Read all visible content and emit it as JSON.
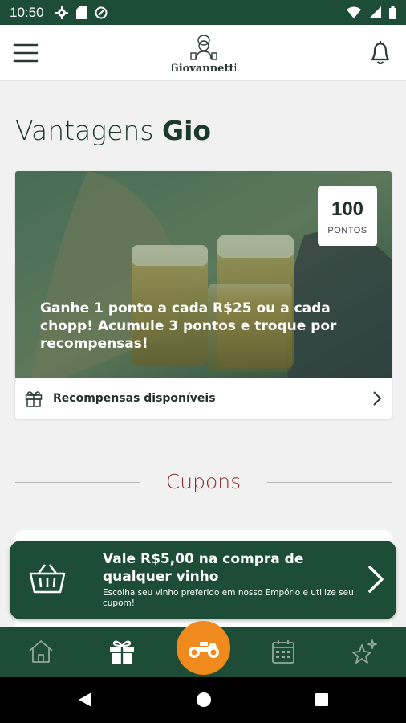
{
  "status_bar": {
    "time": "10:50"
  },
  "header": {
    "brand_name": "Giovannetti"
  },
  "page": {
    "title_light": "Vantagens",
    "title_bold": "Gio"
  },
  "promo": {
    "points_value": "100",
    "points_unit": "PONTOS",
    "text": "Ganhe 1 ponto a cada R$25 ou a cada chopp! Acumule 3 pontos e troque por recompensas!",
    "rewards_label": "Recompensas disponíveis"
  },
  "coupons": {
    "section_title": "Cupons",
    "items": [
      {
        "title": "Vale R$5,00 na compra de qualquer vinho",
        "subtitle": "Escolha seu vinho preferido em nosso Empório e utilize seu cupom!"
      }
    ]
  },
  "bottom_nav": {
    "items": [
      "home-icon",
      "gift-icon",
      "motorcycle-icon",
      "calendar-icon",
      "sparkle-star-icon"
    ],
    "active": "gift-icon"
  },
  "colors": {
    "primary": "#1d4c37",
    "accent": "#f08a1c",
    "section_title": "#8a2a2a"
  }
}
